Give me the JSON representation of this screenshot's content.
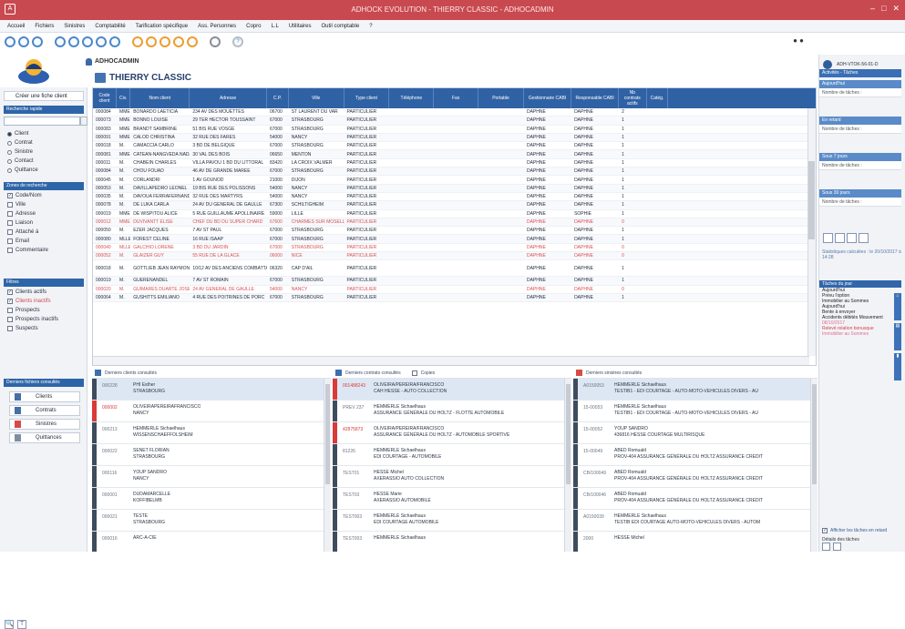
{
  "window": {
    "title": "ADHOCK EVOLUTION - THIERRY CLASSIC - ADHOCADMIN",
    "minimize": "–",
    "maximize": "□",
    "close": "✕"
  },
  "menu": [
    "Accueil",
    "Fichiers",
    "Sinistres",
    "Comptabilité",
    "Tarification spécifique",
    "Ass. Personnes",
    "Copro",
    "L.L",
    "Utilitaires",
    "Outil comptable",
    "?"
  ],
  "user": {
    "name": "ADHOCADMIN",
    "client": "THIERRY CLASSIC"
  },
  "toolbar_right": "● ●",
  "left": {
    "create_button": "Créer une fiche client",
    "search_header": "Recherche rapide",
    "search_value": "",
    "search_types": [
      {
        "label": "Client",
        "checked": true
      },
      {
        "label": "Contrat",
        "checked": false
      },
      {
        "label": "Sinistre",
        "checked": false
      },
      {
        "label": "Contact",
        "checked": false
      },
      {
        "label": "Quittance",
        "checked": false
      }
    ],
    "zone_header": "Zones de recherche",
    "zones": [
      {
        "label": "Code/Nom",
        "checked": true
      },
      {
        "label": "Ville",
        "checked": false
      },
      {
        "label": "Adresse",
        "checked": false
      },
      {
        "label": "Liaison",
        "checked": false
      },
      {
        "label": "Attaché à",
        "checked": false
      },
      {
        "label": "Email",
        "checked": false
      },
      {
        "label": "Commentaire",
        "checked": false
      }
    ],
    "filters_header": "Filtres",
    "filters": [
      {
        "label": "Clients actifs",
        "checked": true,
        "red": false
      },
      {
        "label": "Clients inactifs",
        "checked": true,
        "red": true
      },
      {
        "label": "Prospects",
        "checked": false,
        "red": false
      },
      {
        "label": "Prospects inactifs",
        "checked": false,
        "red": false
      },
      {
        "label": "Suspects",
        "checked": false,
        "red": false
      }
    ],
    "shortcuts_header": "Derniers fichiers consultés",
    "shortcuts": [
      "Clients",
      "Contrats",
      "Sinistres",
      "Quittances"
    ],
    "footer_icons": [
      "🔍",
      "⊤"
    ]
  },
  "grid": {
    "headers": [
      "Code client",
      "Civ.",
      "Nom client",
      "Adresse",
      "C.P.",
      "Ville",
      "Type client",
      "Téléphone",
      "Fax",
      "Portable",
      "Gestionnaire CABI",
      "Responsable CABI",
      "Nb contrats actifs",
      "Catég."
    ],
    "rows": [
      {
        "c": [
          "000084",
          "MME",
          "BONARDO LAETICIA",
          "234 AV DES MOUETTES",
          "06700",
          "ST LAURENT DU VAR",
          "PARTICULIER",
          "",
          "",
          "",
          "DAPHNE",
          "DAPHNE",
          "2",
          ""
        ],
        "red": false
      },
      {
        "c": [
          "000073",
          "MME",
          "BONNO LOUISE",
          "29 TER HECTOR TOUSSAINT",
          "67000",
          "STRASBOURG",
          "PARTICULIER",
          "",
          "",
          "",
          "DAPHNE",
          "DAPHNE",
          "1",
          ""
        ],
        "red": false
      },
      {
        "c": [
          "000083",
          "MME",
          "BRANDT SAMBRINE",
          "51 BIS RUE VOSGE",
          "67000",
          "STRASBOURG",
          "PARTICULIER",
          "",
          "",
          "",
          "DAPHNE",
          "DAPHNE",
          "1",
          ""
        ],
        "red": false
      },
      {
        "c": [
          "000091",
          "MME",
          "CALOD CHRISTINA",
          "32 RUE DES FARES",
          "54000",
          "NANCY",
          "PARTICULIER",
          "",
          "",
          "",
          "DAPHNE",
          "DAPHNE",
          "1",
          ""
        ],
        "red": false
      },
      {
        "c": [
          "000018",
          "M.",
          "CAMACCIA CARLO",
          "3 BD DE BELGIQUE",
          "67000",
          "STRASBOURG",
          "PARTICULIER",
          "",
          "",
          "",
          "DAPHNE",
          "DAPHNE",
          "1",
          ""
        ],
        "red": false
      },
      {
        "c": [
          "000081",
          "MME",
          "CATEAN-NANGVEDA NADALI",
          "30 VAL DES BOIS",
          "06650",
          "MENTON",
          "PARTICULIER",
          "",
          "",
          "",
          "DAPHNE",
          "DAPHNE",
          "1",
          ""
        ],
        "red": false
      },
      {
        "c": [
          "000011",
          "M.",
          "CHABEIN CHARLES",
          "VILLA PAVOU 1 BD DU LITTORAL",
          "83420",
          "LA CROIX VALMER",
          "PARTICULIER",
          "",
          "",
          "",
          "DAPHNE",
          "DAPHNE",
          "1",
          ""
        ],
        "red": false
      },
      {
        "c": [
          "000084",
          "M.",
          "CHOU FOUAD",
          "46 AV DE GRANDE MARÉE",
          "67000",
          "STRASBOURG",
          "PARTICULIER",
          "",
          "",
          "",
          "DAPHNE",
          "DAPHNE",
          "1",
          ""
        ],
        "red": false
      },
      {
        "c": [
          "000045",
          "M.",
          "CORLANDRI",
          "1 AV GOUNOD",
          "21000",
          "DIJON",
          "PARTICULIER",
          "",
          "",
          "",
          "DAPHNE",
          "DAPHNE",
          "1",
          ""
        ],
        "red": false
      },
      {
        "c": [
          "000053",
          "M.",
          "DAVILLAPEDRO LEONEL",
          "19 BIS RUE DES POLISSONS",
          "54000",
          "NANCY",
          "PARTICULIER",
          "",
          "",
          "",
          "DAPHNE",
          "DAPHNE",
          "1",
          ""
        ],
        "red": false
      },
      {
        "c": [
          "000035",
          "M.",
          "DAVOUA FERRAFERNANDO",
          "32 RUE DES MARTYRS",
          "54000",
          "NANCY",
          "PARTICULIER",
          "",
          "",
          "",
          "DAPHNE",
          "DAPHNE",
          "1",
          ""
        ],
        "red": false
      },
      {
        "c": [
          "000078",
          "M.",
          "DE LUKA CARLA",
          "24 AV DU GENERAL DE GAULLE",
          "67300",
          "SCHILTIGHEIM",
          "PARTICULIER",
          "",
          "",
          "",
          "DAPHNE",
          "DAPHNE",
          "1",
          ""
        ],
        "red": false
      },
      {
        "c": [
          "000019",
          "MME",
          "DE WISPITOU ALICE",
          "5 RUE GUILLAUME APOLLINAIRE",
          "59000",
          "LILLE",
          "PARTICULIER",
          "",
          "",
          "",
          "DAPHNE",
          "SOPHIE",
          "1",
          ""
        ],
        "red": false
      },
      {
        "c": [
          "000012",
          "MME",
          "DUVIVANTT ELISE",
          "CHEF DU BD DU SUPER CHARD",
          "67600",
          "CHARMES SUR MOSELLE",
          "PARTICULIER",
          "",
          "",
          "",
          "DAPHNE",
          "DAPHNE",
          "0",
          ""
        ],
        "red": true
      },
      {
        "c": [
          "000050",
          "M.",
          "EZER JACQUES",
          "7 AV ST PAUL",
          "67000",
          "STRASBOURG",
          "PARTICULIER",
          "",
          "",
          "",
          "DAPHNE",
          "DAPHNE",
          "1",
          ""
        ],
        "red": false
      },
      {
        "c": [
          "000080",
          "MLLE",
          "FOREST CELINE",
          "16 RUE ISAAP",
          "67000",
          "STRASBOURG",
          "PARTICULIER",
          "",
          "",
          "",
          "DAPHNE",
          "DAPHNE",
          "1",
          ""
        ],
        "red": false
      },
      {
        "c": [
          "000040",
          "MLLE",
          "GALCHIO LORENE",
          "3 BD DU JARDIN",
          "67000",
          "STRASBOURG",
          "PARTICULIER",
          "",
          "",
          "",
          "DAPHNE",
          "DAPHNE",
          "0",
          ""
        ],
        "red": true
      },
      {
        "c": [
          "000052",
          "M.",
          "GLAIZER GUY",
          "55 RUE DE LA GLACE",
          "06000",
          "NICE",
          "PARTICULIER",
          "",
          "",
          "",
          "DAPHNE",
          "DAPHNE",
          "0",
          ""
        ],
        "red": true
      },
      {
        "c": [
          "000018",
          "M.",
          "GOTTLIEB JEAN RAYMOND",
          "10/12 AV DES ANCIENS COMBATTANTS",
          "06320",
          "CAP D'AIL",
          "PARTICULIER",
          "",
          "",
          "",
          "DAPHNE",
          "DAPHNE",
          "1",
          ""
        ],
        "red": false
      },
      {
        "c": [
          "000019",
          "M.",
          "GUERENANDEL",
          "7 AV ST ROMAIN",
          "67000",
          "STRASBOURG",
          "PARTICULIER",
          "",
          "",
          "",
          "DAPHNE",
          "DAPHNE",
          "1",
          ""
        ],
        "red": false
      },
      {
        "c": [
          "000020",
          "M.",
          "GUIMARES DUARTE JOSE",
          "24 AV GENERAL DE GAULLE",
          "54000",
          "NANCY",
          "PARTICULIER",
          "",
          "",
          "",
          "DAPHNE",
          "DAPHNE",
          "0",
          ""
        ],
        "red": true
      },
      {
        "c": [
          "000064",
          "M.",
          "GUSHITTS EMILIANO",
          "4 RUE DES POITRINES DE PORC",
          "67000",
          "STRASBOURG",
          "PARTICULIER",
          "",
          "",
          "",
          "DAPHNE",
          "DAPHNE",
          "1",
          ""
        ],
        "red": false
      }
    ]
  },
  "panes": [
    {
      "title": "Derniers clients consultés",
      "icon": "user-icon",
      "checkbox": null,
      "rows": [
        {
          "code": "000228",
          "l1": "PHI Esther",
          "l2": "STRASBOURG",
          "red": false,
          "sel": true
        },
        {
          "code": "000002",
          "l1": "OLIVEIRAPEREIRAFRANCISCO",
          "l2": "NANCY",
          "red": true,
          "sel": false
        },
        {
          "code": "000213",
          "l1": "HEMMERLE Sichaelhaus",
          "l2": "WISSENSCHAEFFOLSHEIM",
          "red": false,
          "sel": false
        },
        {
          "code": "000022",
          "l1": "SENET FLORIAN",
          "l2": "STRASBOURG",
          "red": false,
          "sel": false
        },
        {
          "code": "000116",
          "l1": "YOUP SANDRO",
          "l2": "NANCY",
          "red": false,
          "sel": false
        },
        {
          "code": "000001",
          "l1": "DUDAMARCELLE",
          "l2": "KOFFIBELMB",
          "red": false,
          "sel": false
        },
        {
          "code": "000021",
          "l1": "TESTE",
          "l2": "STRASBOURG",
          "red": false,
          "sel": false
        },
        {
          "code": "000016",
          "l1": "ARC-A-CIE",
          "l2": "",
          "red": false,
          "sel": false
        }
      ]
    },
    {
      "title": "Derniers contrats consultés",
      "icon": "contract-icon",
      "checkbox": "Copies",
      "rows": [
        {
          "code": "001488243",
          "l1": "OLIVEIRA/PEREIRA/FRANCISCO",
          "l2": "CAH HESSE - AUTO COLLECTION",
          "red": true,
          "sel": true
        },
        {
          "code": "PREV 237",
          "l1": "HEMMERLE Sichaelhaus",
          "l2": "ASSURANCE GÉNÉRALE DU HOLTZ - FLOTTE AUTOMOBILE",
          "red": false,
          "sel": false
        },
        {
          "code": "42875873",
          "l1": "OLIVEIRA/PEREIRA/FRANCISCO",
          "l2": "ASSURANCE GÉNÉRALE DU HOLTZ - AUTOMOBILE SPORTIVE",
          "red": true,
          "sel": false
        },
        {
          "code": "81226",
          "l1": "HEMMERLE Sichaelhaus",
          "l2": "EDI COURTAGE - AUTOMOBILE",
          "red": false,
          "sel": false
        },
        {
          "code": "TEST01",
          "l1": "HESSE Michel",
          "l2": "AXERASSIO AUTO COLLECTION",
          "red": false,
          "sel": false
        },
        {
          "code": "TEST03",
          "l1": "HESSE Marie",
          "l2": "AXERASSIO AUTOMOBILE",
          "red": false,
          "sel": false
        },
        {
          "code": "TEST003",
          "l1": "HEMMERLE Sichaelhaus",
          "l2": "EDI COURTAGE AUTOMOBILE",
          "red": false,
          "sel": false
        },
        {
          "code": "TEST003",
          "l1": "HEMMERLE Sichaelhaus",
          "l2": "",
          "red": false,
          "sel": false
        }
      ]
    },
    {
      "title": "Derniers sinistres consultés",
      "icon": "claim-icon",
      "checkbox": null,
      "rows": [
        {
          "code": "A0150053",
          "l1": "HEMMERLE Sichaelhaus",
          "l2": "TESTIB1 - EDI COURTAGE - AUTO-MOTO-VEHICULES DIVERS - AU",
          "red": false,
          "sel": true
        },
        {
          "code": "15-00053",
          "l1": "HEMMERLE Sichaelhaus",
          "l2": "TESTIB1 - EDI COURTAGE - AUTO-MOTO-VEHICULES DIVERS - AU",
          "red": false,
          "sel": false
        },
        {
          "code": "15-00052",
          "l1": "YOUP SANDRO",
          "l2": "436816 HESSE COURTAGE MULTIRISQUE",
          "red": false,
          "sel": false
        },
        {
          "code": "15-00049",
          "l1": "ABED Romuald",
          "l2": "PROV-404 ASSURANCE GÉNÉRALE DU HOLTZ ASSURANCE CREDIT",
          "red": false,
          "sel": false
        },
        {
          "code": "CB/100049",
          "l1": "ABED Romuald",
          "l2": "PROV-404 ASSURANCE GÉNÉRALE DU HOLTZ ASSURANCE CREDIT",
          "red": false,
          "sel": false
        },
        {
          "code": "CB/100046",
          "l1": "ABED Romuald",
          "l2": "PROV-404 ASSURANCE GÉNÉRALE DU HOLTZ ASSURANCE CREDIT",
          "red": false,
          "sel": false
        },
        {
          "code": "A0150039",
          "l1": "HEMMERLE Sichaelhaus",
          "l2": "TESTIB EDI COURTAGE AUTO-MOTO-VEHICULES DIVERS - AUTOM",
          "red": false,
          "sel": false
        },
        {
          "code": "2000",
          "l1": "HESSE Michel",
          "l2": "",
          "red": false,
          "sel": false
        }
      ]
    }
  ],
  "right": {
    "login": "ADH-VTOK-56-01-D",
    "alerts_header": "Activités - Tâches",
    "blocks": [
      {
        "h": "Aujourd'hui",
        "b": "Nombre de tâches : "
      },
      {
        "h": "En retard",
        "b": "Nombre de tâches : "
      },
      {
        "h": "Sous 7 jours",
        "b": "Nombre de tâches : "
      },
      {
        "h": "Sous 30 jours",
        "b": "Nombre de tâches : "
      }
    ],
    "stats": "Statistiques calculées : le 20/10/2017 à 14:28",
    "tasks_header": "Tâches du jour",
    "tasks": [
      {
        "t": "Aujourd'hui",
        "s": ""
      },
      {
        "t": "Prévu l'option",
        "s": ""
      },
      {
        "t": "Immobilier au Sommes",
        "s": ""
      },
      {
        "t": "Aujourd'hui",
        "s": ""
      },
      {
        "t": "Bente à envoyer",
        "s": ""
      },
      {
        "t": "Accidents débités Mouvement",
        "s": ""
      },
      {
        "t": "08/10/2017",
        "s": "pink"
      },
      {
        "t": "Relevé relation bonusque",
        "s": "red"
      },
      {
        "t": "Immobilier au Sommes",
        "s": "pink"
      }
    ],
    "vtabs": [
      "⌂",
      "▤",
      "▮"
    ],
    "footer_check": "Afficher les tâches en retard",
    "footer_label": "Détails des tâches"
  }
}
